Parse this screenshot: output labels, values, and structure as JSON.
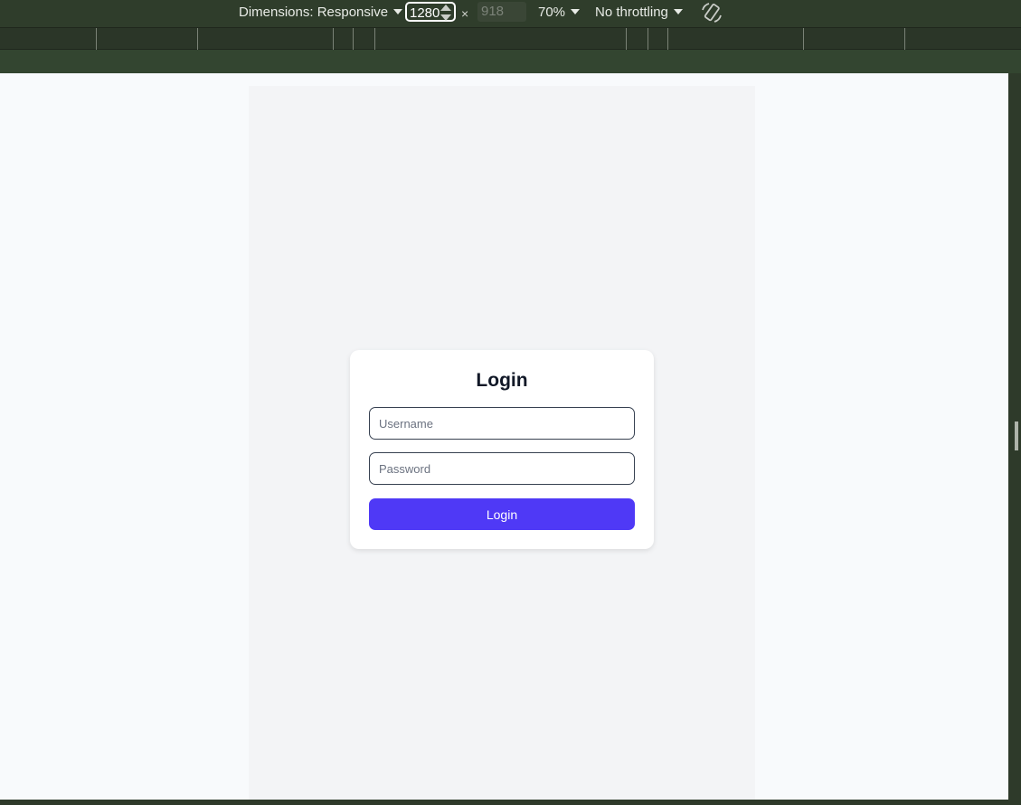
{
  "toolbar": {
    "dimensions_label": "Dimensions: Responsive",
    "width_value": "1280",
    "times_symbol": "×",
    "height_value": "918",
    "zoom_label": "70%",
    "throttling_label": "No throttling",
    "rotate_icon": "rotate-device-icon",
    "caret_icon": "chevron-down-icon"
  },
  "login": {
    "title": "Login",
    "username_placeholder": "Username",
    "password_placeholder": "Password",
    "submit_label": "Login"
  },
  "colors": {
    "toolbar_bg": "#2f3d2b",
    "page_bg": "#f8fafc",
    "device_bg": "#f3f4f6",
    "card_bg": "#ffffff",
    "accent": "#4f39f6",
    "title_text": "#111827"
  }
}
